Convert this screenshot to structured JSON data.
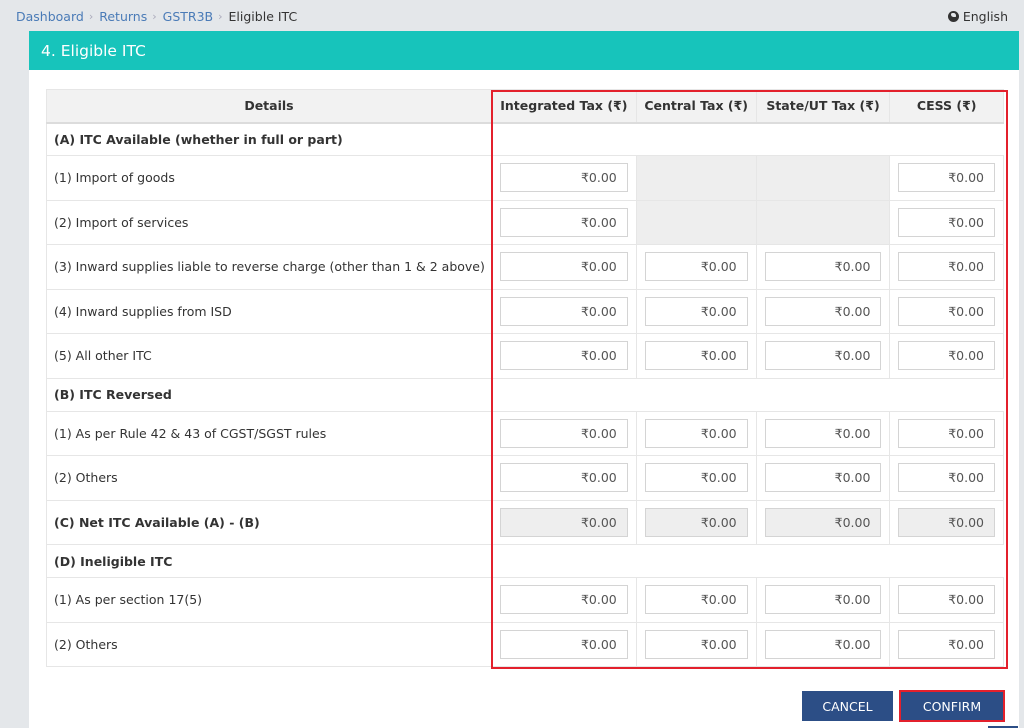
{
  "breadcrumb": {
    "items": [
      "Dashboard",
      "Returns",
      "GSTR3B"
    ],
    "current": "Eligible ITC",
    "separator": "›"
  },
  "language": {
    "icon": "globe-icon",
    "label": "English"
  },
  "panel": {
    "title": "4. Eligible ITC"
  },
  "table": {
    "headers": [
      "Details",
      "Integrated Tax (₹)",
      "Central Tax (₹)",
      "State/UT Tax (₹)",
      "CESS (₹)"
    ],
    "rows": [
      {
        "type": "section",
        "label": "(A) ITC Available (whether in full or part)"
      },
      {
        "type": "row",
        "label": "(1) Import of goods",
        "values": [
          "₹0.00",
          null,
          null,
          "₹0.00"
        ]
      },
      {
        "type": "row",
        "label": "(2) Import of services",
        "values": [
          "₹0.00",
          null,
          null,
          "₹0.00"
        ]
      },
      {
        "type": "row",
        "label": "(3) Inward supplies liable to reverse charge (other than 1 & 2 above)",
        "values": [
          "₹0.00",
          "₹0.00",
          "₹0.00",
          "₹0.00"
        ]
      },
      {
        "type": "row",
        "label": "(4) Inward supplies from ISD",
        "values": [
          "₹0.00",
          "₹0.00",
          "₹0.00",
          "₹0.00"
        ]
      },
      {
        "type": "row",
        "label": "(5) All other ITC",
        "values": [
          "₹0.00",
          "₹0.00",
          "₹0.00",
          "₹0.00"
        ]
      },
      {
        "type": "section",
        "label": "(B) ITC Reversed"
      },
      {
        "type": "row",
        "label": "(1) As per Rule 42 & 43 of CGST/SGST rules",
        "values": [
          "₹0.00",
          "₹0.00",
          "₹0.00",
          "₹0.00"
        ]
      },
      {
        "type": "row",
        "label": "(2) Others",
        "values": [
          "₹0.00",
          "₹0.00",
          "₹0.00",
          "₹0.00"
        ]
      },
      {
        "type": "row",
        "label": "(C) Net ITC Available (A) - (B)",
        "bold": true,
        "readonly": true,
        "values": [
          "₹0.00",
          "₹0.00",
          "₹0.00",
          "₹0.00"
        ]
      },
      {
        "type": "section",
        "label": "(D) Ineligible ITC"
      },
      {
        "type": "row",
        "label": "(1) As per section 17(5)",
        "values": [
          "₹0.00",
          "₹0.00",
          "₹0.00",
          "₹0.00"
        ]
      },
      {
        "type": "row",
        "label": "(2) Others",
        "values": [
          "₹0.00",
          "₹0.00",
          "₹0.00",
          "₹0.00"
        ]
      }
    ]
  },
  "buttons": {
    "cancel": "CANCEL",
    "confirm": "CONFIRM"
  },
  "colors": {
    "header_teal": "#17c4bb",
    "button_blue": "#2c4e86",
    "highlight_red": "#e3202c",
    "link_blue": "#4a7bb7"
  }
}
